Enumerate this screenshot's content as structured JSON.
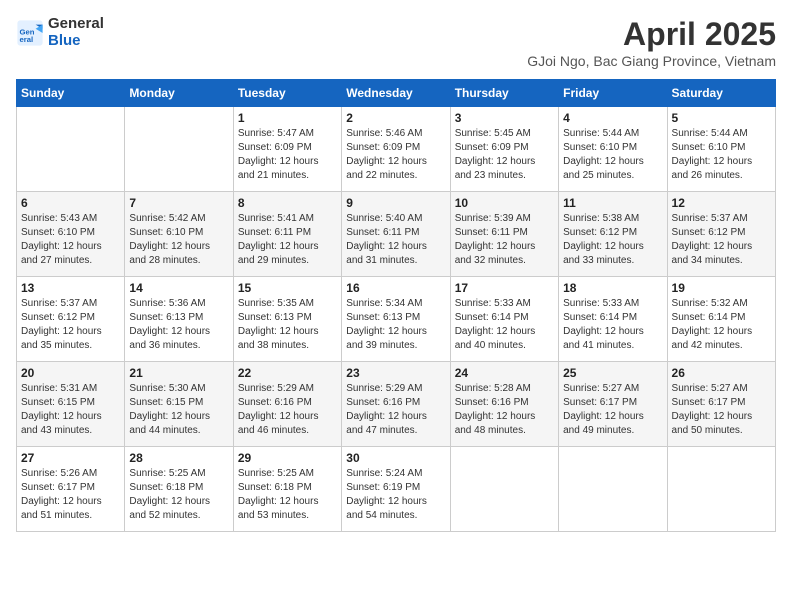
{
  "header": {
    "logo_line1": "General",
    "logo_line2": "Blue",
    "title": "April 2025",
    "subtitle": "GJoi Ngo, Bac Giang Province, Vietnam"
  },
  "days_of_week": [
    "Sunday",
    "Monday",
    "Tuesday",
    "Wednesday",
    "Thursday",
    "Friday",
    "Saturday"
  ],
  "weeks": [
    [
      {
        "day": "",
        "info": ""
      },
      {
        "day": "",
        "info": ""
      },
      {
        "day": "1",
        "info": "Sunrise: 5:47 AM\nSunset: 6:09 PM\nDaylight: 12 hours and 21 minutes."
      },
      {
        "day": "2",
        "info": "Sunrise: 5:46 AM\nSunset: 6:09 PM\nDaylight: 12 hours and 22 minutes."
      },
      {
        "day": "3",
        "info": "Sunrise: 5:45 AM\nSunset: 6:09 PM\nDaylight: 12 hours and 23 minutes."
      },
      {
        "day": "4",
        "info": "Sunrise: 5:44 AM\nSunset: 6:10 PM\nDaylight: 12 hours and 25 minutes."
      },
      {
        "day": "5",
        "info": "Sunrise: 5:44 AM\nSunset: 6:10 PM\nDaylight: 12 hours and 26 minutes."
      }
    ],
    [
      {
        "day": "6",
        "info": "Sunrise: 5:43 AM\nSunset: 6:10 PM\nDaylight: 12 hours and 27 minutes."
      },
      {
        "day": "7",
        "info": "Sunrise: 5:42 AM\nSunset: 6:10 PM\nDaylight: 12 hours and 28 minutes."
      },
      {
        "day": "8",
        "info": "Sunrise: 5:41 AM\nSunset: 6:11 PM\nDaylight: 12 hours and 29 minutes."
      },
      {
        "day": "9",
        "info": "Sunrise: 5:40 AM\nSunset: 6:11 PM\nDaylight: 12 hours and 31 minutes."
      },
      {
        "day": "10",
        "info": "Sunrise: 5:39 AM\nSunset: 6:11 PM\nDaylight: 12 hours and 32 minutes."
      },
      {
        "day": "11",
        "info": "Sunrise: 5:38 AM\nSunset: 6:12 PM\nDaylight: 12 hours and 33 minutes."
      },
      {
        "day": "12",
        "info": "Sunrise: 5:37 AM\nSunset: 6:12 PM\nDaylight: 12 hours and 34 minutes."
      }
    ],
    [
      {
        "day": "13",
        "info": "Sunrise: 5:37 AM\nSunset: 6:12 PM\nDaylight: 12 hours and 35 minutes."
      },
      {
        "day": "14",
        "info": "Sunrise: 5:36 AM\nSunset: 6:13 PM\nDaylight: 12 hours and 36 minutes."
      },
      {
        "day": "15",
        "info": "Sunrise: 5:35 AM\nSunset: 6:13 PM\nDaylight: 12 hours and 38 minutes."
      },
      {
        "day": "16",
        "info": "Sunrise: 5:34 AM\nSunset: 6:13 PM\nDaylight: 12 hours and 39 minutes."
      },
      {
        "day": "17",
        "info": "Sunrise: 5:33 AM\nSunset: 6:14 PM\nDaylight: 12 hours and 40 minutes."
      },
      {
        "day": "18",
        "info": "Sunrise: 5:33 AM\nSunset: 6:14 PM\nDaylight: 12 hours and 41 minutes."
      },
      {
        "day": "19",
        "info": "Sunrise: 5:32 AM\nSunset: 6:14 PM\nDaylight: 12 hours and 42 minutes."
      }
    ],
    [
      {
        "day": "20",
        "info": "Sunrise: 5:31 AM\nSunset: 6:15 PM\nDaylight: 12 hours and 43 minutes."
      },
      {
        "day": "21",
        "info": "Sunrise: 5:30 AM\nSunset: 6:15 PM\nDaylight: 12 hours and 44 minutes."
      },
      {
        "day": "22",
        "info": "Sunrise: 5:29 AM\nSunset: 6:16 PM\nDaylight: 12 hours and 46 minutes."
      },
      {
        "day": "23",
        "info": "Sunrise: 5:29 AM\nSunset: 6:16 PM\nDaylight: 12 hours and 47 minutes."
      },
      {
        "day": "24",
        "info": "Sunrise: 5:28 AM\nSunset: 6:16 PM\nDaylight: 12 hours and 48 minutes."
      },
      {
        "day": "25",
        "info": "Sunrise: 5:27 AM\nSunset: 6:17 PM\nDaylight: 12 hours and 49 minutes."
      },
      {
        "day": "26",
        "info": "Sunrise: 5:27 AM\nSunset: 6:17 PM\nDaylight: 12 hours and 50 minutes."
      }
    ],
    [
      {
        "day": "27",
        "info": "Sunrise: 5:26 AM\nSunset: 6:17 PM\nDaylight: 12 hours and 51 minutes."
      },
      {
        "day": "28",
        "info": "Sunrise: 5:25 AM\nSunset: 6:18 PM\nDaylight: 12 hours and 52 minutes."
      },
      {
        "day": "29",
        "info": "Sunrise: 5:25 AM\nSunset: 6:18 PM\nDaylight: 12 hours and 53 minutes."
      },
      {
        "day": "30",
        "info": "Sunrise: 5:24 AM\nSunset: 6:19 PM\nDaylight: 12 hours and 54 minutes."
      },
      {
        "day": "",
        "info": ""
      },
      {
        "day": "",
        "info": ""
      },
      {
        "day": "",
        "info": ""
      }
    ]
  ]
}
